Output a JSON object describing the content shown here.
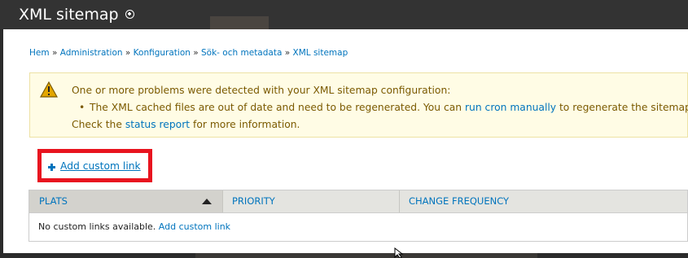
{
  "page": {
    "title": "XML sitemap"
  },
  "breadcrumb": {
    "items": [
      "Hem",
      "Administration",
      "Konfiguration",
      "Sök- och metadata",
      "XML sitemap"
    ],
    "separator": "»"
  },
  "warning": {
    "line1": "One or more problems were detected with your XML sitemap configuration:",
    "line2_before": "The XML cached files are out of date and need to be regenerated. You can ",
    "line2_link": "run cron manually",
    "line2_after": " to regenerate the sitemap files.",
    "line3_before": "Check the ",
    "line3_link": "status report",
    "line3_after": " for more information."
  },
  "actions": {
    "add_custom_link": "Add custom link"
  },
  "table": {
    "columns": [
      "PLATS",
      "PRIORITY",
      "CHANGE FREQUENCY"
    ],
    "empty_text": "No custom links available.",
    "empty_link": "Add custom link"
  },
  "colors": {
    "link": "#0074bd",
    "highlight_border": "#e8141f",
    "warning_bg": "#fffce5",
    "warning_text": "#7b5a00",
    "header_bg": "#333333"
  }
}
